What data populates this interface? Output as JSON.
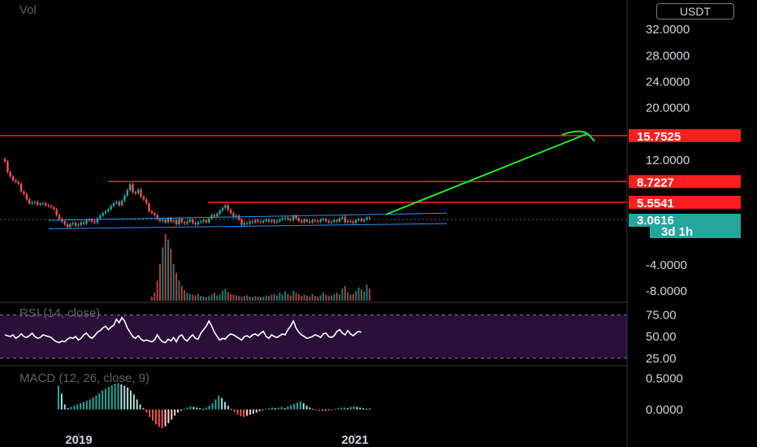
{
  "volume_label": "Vol",
  "currency": "USDT",
  "colors": {
    "up": "#26a69a",
    "down": "#ef5350",
    "level": "#ff1e1e",
    "channel": "#2196f3",
    "projection": "#22e833",
    "rsi_line": "#ffffff",
    "rsi_band": "#2a0f3a",
    "price_tag": "#26a69a"
  },
  "chart_data": [
    {
      "type": "candlestick",
      "title": "",
      "y_ticks": [
        "32.0000",
        "28.0000",
        "24.0000",
        "20.0000",
        "12.0000",
        "-4.0000",
        "-8.0000"
      ],
      "ylim": [
        -9.5,
        36.5
      ],
      "x_ticks": [
        "2019",
        "2021"
      ],
      "last_price": "3.0616",
      "countdown": "3d 1h",
      "levels": [
        {
          "label": "15.7525",
          "value": 15.7525
        },
        {
          "label": "8.7227",
          "value": 8.7227
        },
        {
          "label": "5.5541",
          "value": 5.5541
        }
      ],
      "channel": {
        "lower": [
          1.5,
          2.3
        ],
        "upper": [
          2.8,
          3.9
        ]
      },
      "projection_target": 15.7525,
      "close": [
        11.8,
        10.2,
        9.5,
        8.9,
        8.7,
        8.4,
        7.2,
        6.8,
        6.0,
        5.4,
        5.5,
        5.6,
        5.2,
        5.3,
        5.4,
        5.1,
        5.0,
        4.8,
        4.5,
        3.6,
        3.0,
        2.6,
        2.2,
        1.8,
        2.2,
        2.4,
        2.0,
        2.1,
        2.5,
        2.3,
        2.8,
        2.9,
        2.6,
        2.4,
        3.1,
        3.5,
        3.9,
        4.2,
        4.5,
        5.0,
        5.4,
        5.6,
        5.1,
        5.8,
        6.6,
        7.4,
        8.3,
        7.1,
        6.9,
        7.5,
        6.4,
        6.0,
        5.4,
        4.2,
        3.9,
        3.6,
        3.0,
        2.7,
        2.9,
        2.5,
        3.1,
        2.6,
        2.8,
        2.2,
        3.0,
        2.5,
        2.3,
        2.6,
        2.9,
        2.4,
        2.2,
        2.5,
        2.6,
        2.8,
        2.5,
        3.1,
        3.6,
        3.4,
        3.8,
        4.3,
        4.7,
        5.1,
        4.4,
        3.9,
        3.3,
        3.5,
        2.9,
        2.1,
        2.4,
        2.3,
        2.6,
        2.5,
        2.8,
        2.6,
        2.5,
        2.7,
        2.9,
        2.6,
        2.8,
        2.5,
        2.7,
        2.9,
        3.1,
        3.2,
        3.0,
        2.8,
        3.5,
        3.1,
        2.7,
        2.5,
        2.9,
        2.6,
        2.5,
        2.8,
        2.7,
        2.6,
        2.9,
        3.0,
        2.7,
        2.5,
        2.6,
        2.8,
        2.6,
        3.1,
        3.3,
        2.5,
        2.7,
        2.6,
        2.4,
        2.8,
        3.0,
        2.7,
        2.9,
        3.2,
        3.1
      ],
      "volume": [
        0,
        0,
        0,
        0,
        0,
        0,
        0,
        0,
        0,
        0,
        0,
        0,
        0,
        0,
        0,
        0,
        0,
        0,
        0,
        0,
        0,
        0,
        0,
        0,
        0,
        0,
        0,
        0,
        0,
        0,
        0,
        0,
        0,
        0,
        0,
        0,
        0,
        0,
        0,
        0,
        0,
        0,
        0,
        0,
        0,
        0,
        0,
        0,
        0,
        0,
        0,
        0,
        0,
        0,
        0.06,
        0.12,
        0.3,
        0.55,
        0.8,
        1.0,
        0.92,
        0.78,
        0.55,
        0.42,
        0.3,
        0.22,
        0.16,
        0.12,
        0.1,
        0.09,
        0.08,
        0.1,
        0.07,
        0.06,
        0.05,
        0.07,
        0.09,
        0.12,
        0.08,
        0.1,
        0.15,
        0.18,
        0.13,
        0.1,
        0.09,
        0.08,
        0.07,
        0.06,
        0.07,
        0.08,
        0.06,
        0.05,
        0.07,
        0.06,
        0.05,
        0.06,
        0.08,
        0.07,
        0.09,
        0.1,
        0.08,
        0.12,
        0.09,
        0.14,
        0.1,
        0.08,
        0.15,
        0.12,
        0.1,
        0.07,
        0.09,
        0.08,
        0.06,
        0.1,
        0.07,
        0.06,
        0.08,
        0.12,
        0.09,
        0.07,
        0.08,
        0.1,
        0.12,
        0.09,
        0.18,
        0.22,
        0.12,
        0.09,
        0.1,
        0.15,
        0.2,
        0.17,
        0.14,
        0.24,
        0.18
      ],
      "series": [
        {
          "values": []
        }
      ]
    },
    {
      "type": "line",
      "title": "RSI (14, close)",
      "y_ticks": [
        "75.00",
        "50.00",
        "25.00"
      ],
      "ylim": [
        22,
        82
      ],
      "band": [
        25,
        75
      ],
      "values": [
        52,
        51,
        50,
        52,
        48,
        50,
        53,
        50,
        49,
        51,
        54,
        50,
        48,
        49,
        52,
        51,
        50,
        49,
        46,
        44,
        43,
        45,
        44,
        47,
        49,
        48,
        50,
        46,
        48,
        52,
        54,
        50,
        48,
        51,
        55,
        57,
        60,
        62,
        58,
        61,
        63,
        70,
        66,
        72,
        68,
        60,
        55,
        50,
        48,
        51,
        47,
        45,
        46,
        45,
        44,
        46,
        52,
        47,
        44,
        43,
        47,
        45,
        49,
        44,
        50,
        52,
        47,
        45,
        49,
        52,
        48,
        47,
        54,
        58,
        62,
        68,
        62,
        55,
        50,
        46,
        48,
        47,
        51,
        53,
        52,
        50,
        48,
        46,
        50,
        51,
        49,
        52,
        53,
        51,
        54,
        56,
        50,
        48,
        52,
        50,
        49,
        51,
        53,
        52,
        58,
        62,
        68,
        60,
        55,
        52,
        50,
        48,
        49,
        50,
        52,
        51,
        49,
        53,
        54,
        50,
        49,
        51,
        56,
        58,
        54,
        52,
        57,
        53,
        51,
        54,
        56,
        55
      ]
    },
    {
      "type": "bar",
      "title": "MACD (12, 26, close, 9)",
      "y_ticks": [
        "0.5000",
        "0.0000"
      ],
      "ylim": [
        -0.34,
        0.62
      ],
      "values": [
        0.38,
        0.25,
        0.08,
        0.02,
        0.04,
        0.06,
        0.08,
        0.1,
        0.12,
        0.14,
        0.16,
        0.19,
        0.22,
        0.26,
        0.3,
        0.33,
        0.36,
        0.39,
        0.41,
        0.42,
        0.4,
        0.38,
        0.35,
        0.3,
        0.24,
        0.16,
        0.08,
        0.02,
        -0.05,
        -0.12,
        -0.18,
        -0.24,
        -0.28,
        -0.3,
        -0.27,
        -0.22,
        -0.16,
        -0.1,
        -0.05,
        -0.02,
        0.01,
        0.03,
        0.05,
        0.04,
        0.03,
        0.02,
        0.01,
        0.03,
        0.06,
        0.1,
        0.16,
        0.22,
        0.18,
        0.12,
        0.06,
        0.01,
        -0.04,
        -0.08,
        -0.11,
        -0.12,
        -0.1,
        -0.08,
        -0.07,
        -0.05,
        -0.03,
        -0.01,
        0.01,
        0.02,
        0.03,
        0.02,
        0.03,
        0.04,
        0.02,
        0.05,
        0.07,
        0.09,
        0.11,
        0.13,
        0.1,
        0.06,
        0.03,
        0.01,
        -0.01,
        -0.02,
        -0.03,
        -0.02,
        -0.01,
        -0.01,
        0.01,
        0.02,
        0.03,
        0.03,
        0.02,
        0.04,
        0.05,
        0.04,
        0.03,
        0.02,
        0.01,
        0.02
      ]
    }
  ]
}
